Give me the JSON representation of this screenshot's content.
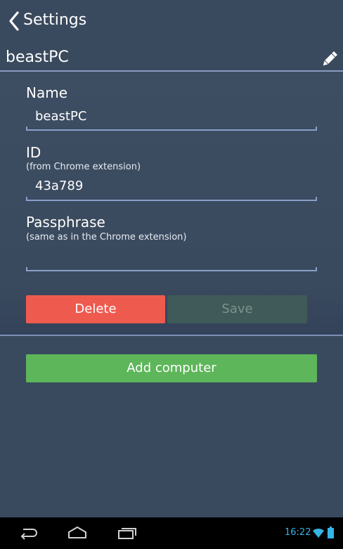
{
  "topbar": {
    "title": "Settings"
  },
  "computer": {
    "name": "beastPC"
  },
  "form": {
    "name_label": "Name",
    "name_value": "beastPC",
    "id_label": "ID",
    "id_hint": "(from Chrome extension)",
    "id_value": "43a789",
    "passphrase_label": "Passphrase",
    "passphrase_hint": "(same as in the Chrome extension)",
    "passphrase_value": ""
  },
  "buttons": {
    "delete": "Delete",
    "save": "Save",
    "add_computer": "Add computer"
  },
  "status_bar": {
    "time": "16:22"
  },
  "icons": {
    "back": "chevron-left-icon",
    "edit": "pencil-icon",
    "nav_back": "back-icon",
    "nav_home": "home-icon",
    "nav_recents": "recents-icon",
    "wifi": "wifi-icon",
    "battery": "battery-icon"
  },
  "colors": {
    "background": "#3a4a5e",
    "delete": "#ef5a4f",
    "save_disabled": "#3f5a58",
    "add": "#5db659",
    "clock": "#33b5e5"
  }
}
